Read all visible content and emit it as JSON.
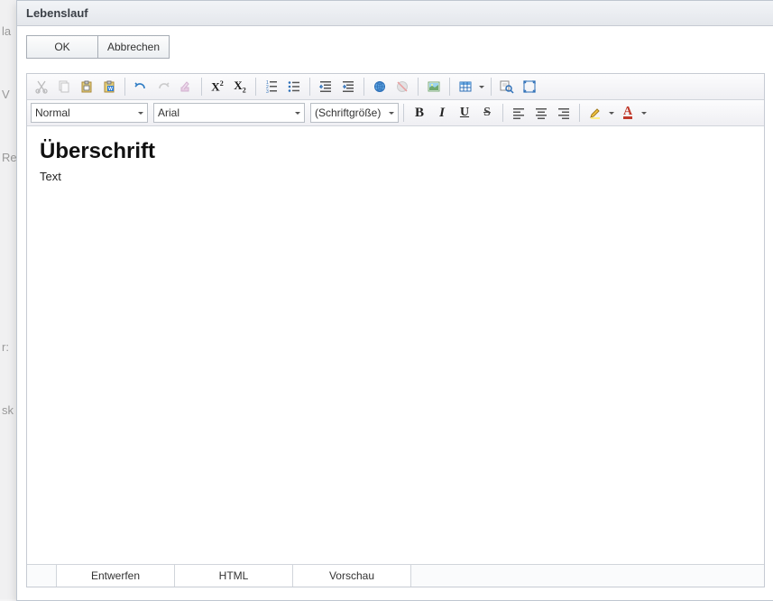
{
  "dialog": {
    "title": "Lebenslauf"
  },
  "buttons": {
    "ok": "OK",
    "cancel": "Abbrechen"
  },
  "editor": {
    "paragraph": "Normal",
    "font": "Arial",
    "size": "(Schriftgröße)",
    "content": {
      "heading": "Überschrift",
      "body": "Text"
    }
  },
  "tabs": {
    "design": "Entwerfen",
    "html": "HTML",
    "preview": "Vorschau"
  },
  "icons": {
    "cut": "cut",
    "copy": "copy",
    "paste": "paste",
    "paste_word": "paste-word",
    "undo": "undo",
    "redo": "redo",
    "format_stripper": "format-stripper",
    "superscript": "superscript",
    "subscript": "subscript",
    "ol": "ordered-list",
    "ul": "unordered-list",
    "outdent": "outdent",
    "indent": "indent",
    "link": "link",
    "unlink": "unlink",
    "image": "image",
    "table": "table",
    "find": "find-replace",
    "fullscreen": "fullscreen",
    "bold": "bold",
    "italic": "italic",
    "underline": "underline",
    "strike": "strikethrough",
    "align_left": "align-left",
    "align_center": "align-center",
    "align_right": "align-right",
    "highlight": "highlight-color",
    "font_color": "font-color"
  }
}
